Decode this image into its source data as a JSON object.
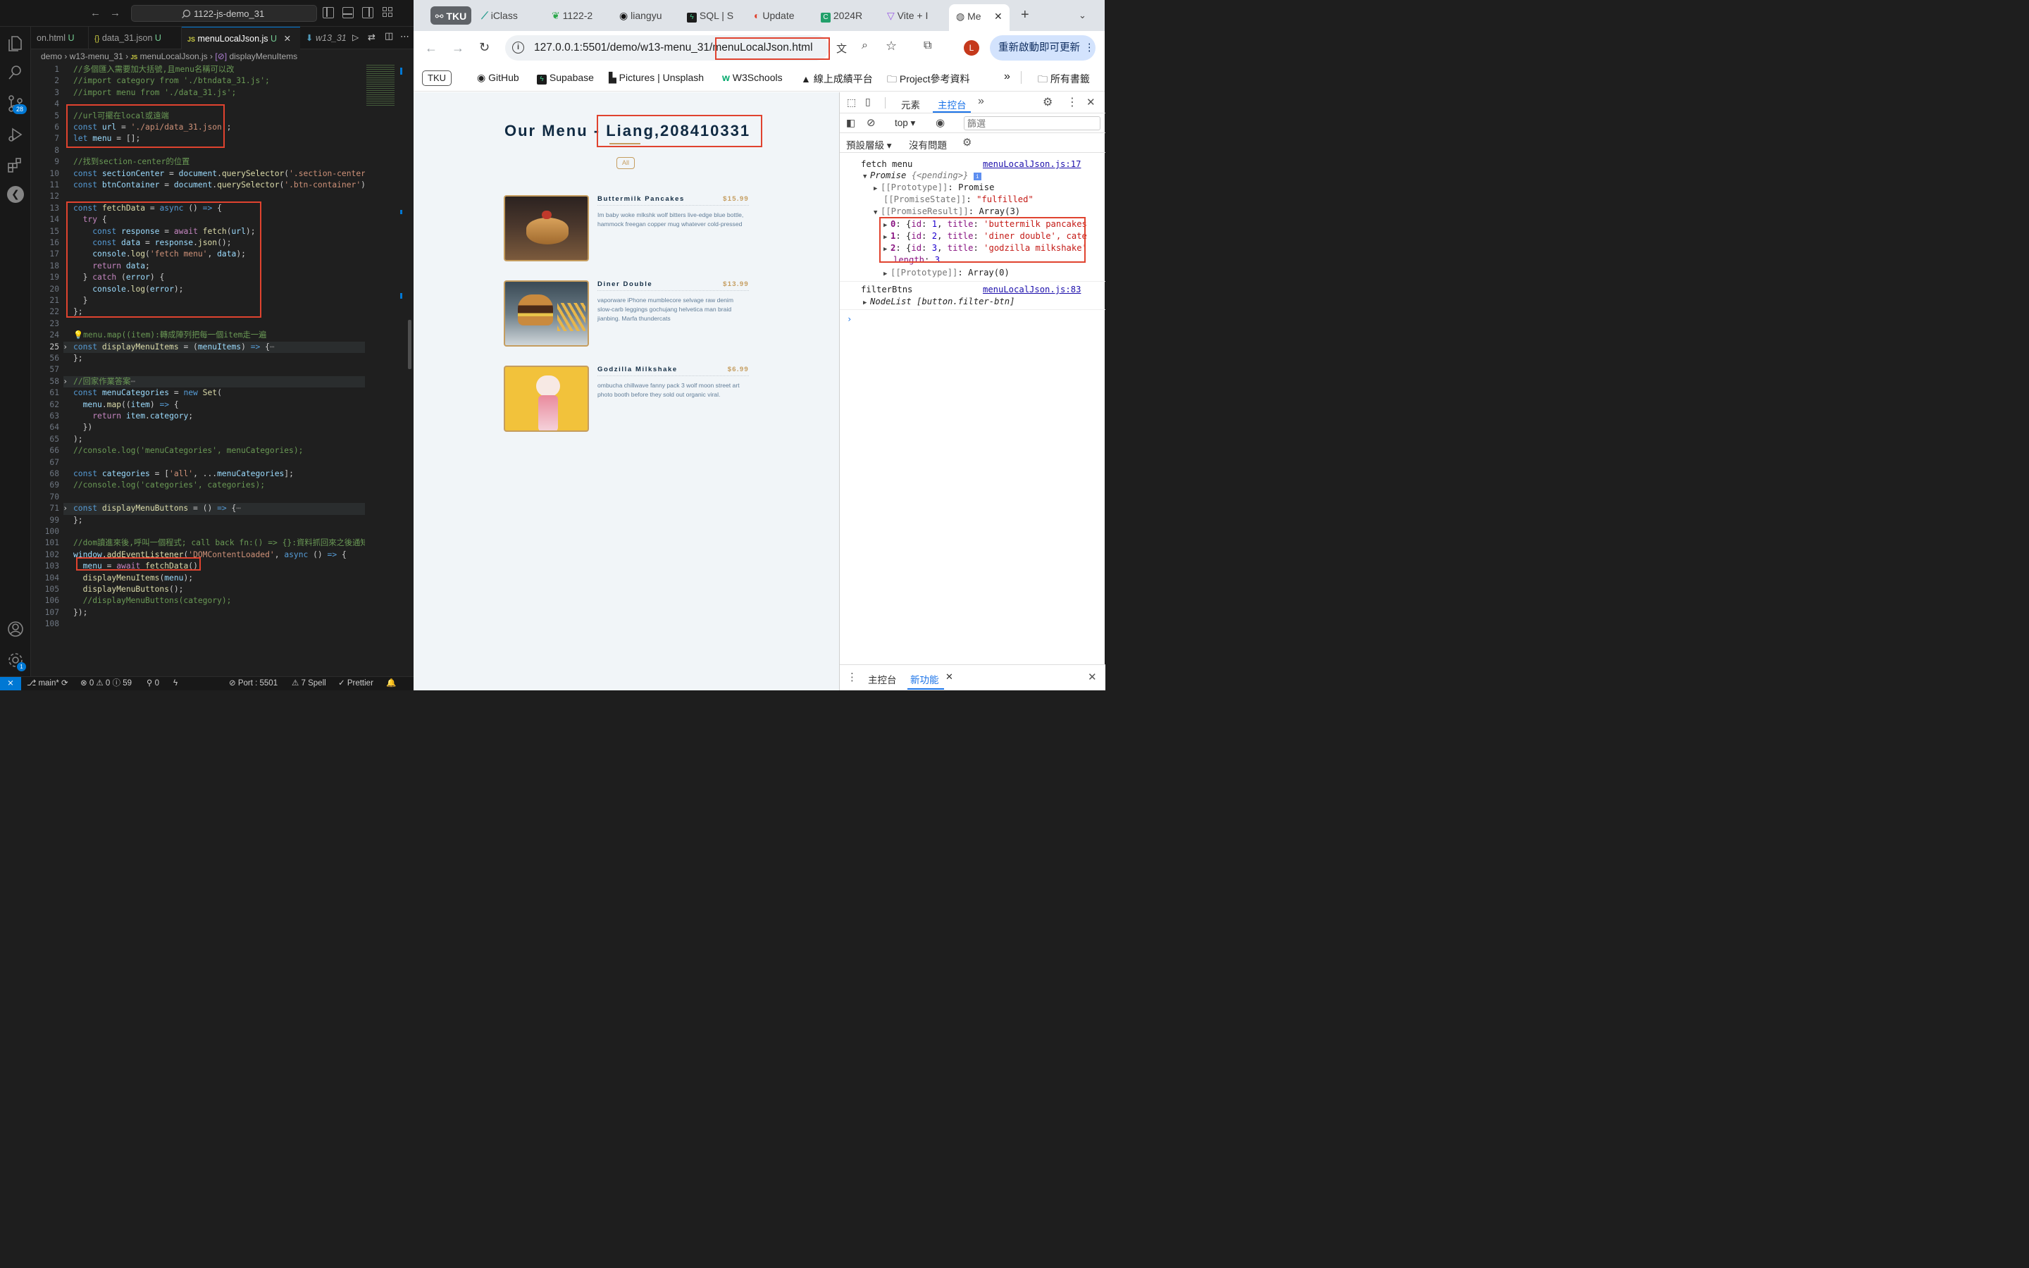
{
  "vscode": {
    "search": "1122-js-demo_31",
    "scm_badge": "28",
    "settings_badge": "1",
    "tabs": [
      {
        "label": "on.html",
        "mod": "U"
      },
      {
        "label": "data_31.json",
        "mod": "U",
        "icon": "{}"
      },
      {
        "label": "menuLocalJson.js",
        "mod": "U",
        "icon": "JS"
      },
      {
        "label": "w13_31",
        "mod": ""
      }
    ],
    "breadcrumb": [
      "demo",
      "w13-menu_31",
      "menuLocalJson.js",
      "displayMenuItems"
    ],
    "lines": [
      {
        "n": "1",
        "segs": [
          [
            "c-com",
            "//多個匯入需要加大括號,且menu名稱可以改"
          ]
        ]
      },
      {
        "n": "2",
        "segs": [
          [
            "c-com",
            "//import category from './btndata_31.js';"
          ]
        ]
      },
      {
        "n": "3",
        "segs": [
          [
            "c-com",
            "//import menu from './data_31.js';"
          ]
        ]
      },
      {
        "n": "4",
        "segs": []
      },
      {
        "n": "5",
        "segs": [
          [
            "c-com",
            "//url可擺在local或遠端"
          ]
        ]
      },
      {
        "n": "6",
        "segs": [
          [
            "c-kw",
            "const "
          ],
          [
            "c-var",
            "url"
          ],
          [
            "",
            " = "
          ],
          [
            "c-str",
            "'./api/data_31.json'"
          ],
          [
            "",
            ";"
          ]
        ]
      },
      {
        "n": "7",
        "segs": [
          [
            "c-kw",
            "let "
          ],
          [
            "c-var",
            "menu"
          ],
          [
            "",
            " = [];"
          ]
        ]
      },
      {
        "n": "8",
        "segs": []
      },
      {
        "n": "9",
        "segs": [
          [
            "c-com",
            "//找到section-center的位置"
          ]
        ]
      },
      {
        "n": "10",
        "segs": [
          [
            "c-kw",
            "const "
          ],
          [
            "c-var",
            "sectionCenter"
          ],
          [
            "",
            " = "
          ],
          [
            "c-var",
            "document"
          ],
          [
            "",
            "."
          ],
          [
            "c-fn",
            "querySelector"
          ],
          [
            "",
            "("
          ],
          [
            "c-str",
            "'.section-center'"
          ],
          [
            "",
            ")"
          ]
        ]
      },
      {
        "n": "11",
        "segs": [
          [
            "c-kw",
            "const "
          ],
          [
            "c-var",
            "btnContainer"
          ],
          [
            "",
            " = "
          ],
          [
            "c-var",
            "document"
          ],
          [
            "",
            "."
          ],
          [
            "c-fn",
            "querySelector"
          ],
          [
            "",
            "("
          ],
          [
            "c-str",
            "'.btn-container'"
          ],
          [
            "",
            ");"
          ]
        ]
      },
      {
        "n": "12",
        "segs": []
      },
      {
        "n": "13",
        "segs": [
          [
            "c-kw",
            "const "
          ],
          [
            "c-fn",
            "fetchData"
          ],
          [
            "",
            " = "
          ],
          [
            "c-kw",
            "async"
          ],
          [
            "",
            " () "
          ],
          [
            "c-kw",
            "=>"
          ],
          [
            "",
            " {"
          ]
        ]
      },
      {
        "n": "14",
        "segs": [
          [
            "",
            "  "
          ],
          [
            "c-ctl",
            "try"
          ],
          [
            "",
            " {"
          ]
        ]
      },
      {
        "n": "15",
        "segs": [
          [
            "",
            "    "
          ],
          [
            "c-kw",
            "const "
          ],
          [
            "c-var",
            "response"
          ],
          [
            "",
            " = "
          ],
          [
            "c-ctl",
            "await "
          ],
          [
            "c-fn",
            "fetch"
          ],
          [
            "",
            "("
          ],
          [
            "c-var",
            "url"
          ],
          [
            "",
            ");"
          ]
        ]
      },
      {
        "n": "16",
        "segs": [
          [
            "",
            "    "
          ],
          [
            "c-kw",
            "const "
          ],
          [
            "c-var",
            "data"
          ],
          [
            "",
            " = "
          ],
          [
            "c-var",
            "response"
          ],
          [
            "",
            "."
          ],
          [
            "c-fn",
            "json"
          ],
          [
            "",
            "();"
          ]
        ]
      },
      {
        "n": "17",
        "segs": [
          [
            "",
            "    "
          ],
          [
            "c-var",
            "console"
          ],
          [
            "",
            "."
          ],
          [
            "c-fn",
            "log"
          ],
          [
            "",
            "("
          ],
          [
            "c-str",
            "'fetch menu'"
          ],
          [
            "",
            ", "
          ],
          [
            "c-var",
            "data"
          ],
          [
            "",
            ");"
          ]
        ]
      },
      {
        "n": "18",
        "segs": [
          [
            "",
            "    "
          ],
          [
            "c-ctl",
            "return "
          ],
          [
            "c-var",
            "data"
          ],
          [
            "",
            ";"
          ]
        ]
      },
      {
        "n": "19",
        "segs": [
          [
            "",
            "  } "
          ],
          [
            "c-ctl",
            "catch"
          ],
          [
            "",
            " ("
          ],
          [
            "c-var",
            "error"
          ],
          [
            "",
            ") {"
          ]
        ]
      },
      {
        "n": "20",
        "segs": [
          [
            "",
            "    "
          ],
          [
            "c-var",
            "console"
          ],
          [
            "",
            "."
          ],
          [
            "c-fn",
            "log"
          ],
          [
            "",
            "("
          ],
          [
            "c-var",
            "error"
          ],
          [
            "",
            ");"
          ]
        ]
      },
      {
        "n": "21",
        "segs": [
          [
            "",
            "  }"
          ]
        ]
      },
      {
        "n": "22",
        "segs": [
          [
            "",
            "};"
          ]
        ]
      },
      {
        "n": "23",
        "segs": []
      },
      {
        "n": "24",
        "segs": [
          [
            "c-com",
            "💡menu.map((item):轉成陣列把每一個item走一遍"
          ]
        ]
      },
      {
        "n": "25",
        "fold": true,
        "segs": [
          [
            "c-kw",
            "const "
          ],
          [
            "c-fn",
            "displayMenuItems"
          ],
          [
            "",
            " = ("
          ],
          [
            "c-var",
            "menuItems"
          ],
          [
            "",
            ") "
          ],
          [
            "c-kw",
            "=>"
          ],
          [
            "",
            " {"
          ],
          [
            "c-gray",
            "⋯"
          ]
        ]
      },
      {
        "n": "56",
        "segs": [
          [
            "",
            "};"
          ]
        ]
      },
      {
        "n": "57",
        "segs": []
      },
      {
        "n": "58",
        "fold": true,
        "segs": [
          [
            "c-com",
            "//回家作業答案"
          ],
          [
            "c-gray",
            "⋯"
          ]
        ]
      },
      {
        "n": "61",
        "segs": [
          [
            "c-kw",
            "const "
          ],
          [
            "c-var",
            "menuCategories"
          ],
          [
            "",
            " = "
          ],
          [
            "c-kw",
            "new "
          ],
          [
            "c-fn",
            "Set"
          ],
          [
            "",
            "("
          ]
        ]
      },
      {
        "n": "62",
        "segs": [
          [
            "",
            "  "
          ],
          [
            "c-var",
            "menu"
          ],
          [
            "",
            "."
          ],
          [
            "c-fn",
            "map"
          ],
          [
            "",
            "(("
          ],
          [
            "c-var",
            "item"
          ],
          [
            "",
            ") "
          ],
          [
            "c-kw",
            "=>"
          ],
          [
            "",
            " {"
          ]
        ]
      },
      {
        "n": "63",
        "segs": [
          [
            "",
            "    "
          ],
          [
            "c-ctl",
            "return "
          ],
          [
            "c-var",
            "item"
          ],
          [
            "",
            "."
          ],
          [
            "c-var",
            "category"
          ],
          [
            "",
            ";"
          ]
        ]
      },
      {
        "n": "64",
        "segs": [
          [
            "",
            "  })"
          ]
        ]
      },
      {
        "n": "65",
        "segs": [
          [
            "",
            ");"
          ]
        ]
      },
      {
        "n": "66",
        "segs": [
          [
            "c-com",
            "//console.log('menuCategories', menuCategories);"
          ]
        ]
      },
      {
        "n": "67",
        "segs": []
      },
      {
        "n": "68",
        "segs": [
          [
            "c-kw",
            "const "
          ],
          [
            "c-var",
            "categories"
          ],
          [
            "",
            " = ["
          ],
          [
            "c-str",
            "'all'"
          ],
          [
            "",
            ", ..."
          ],
          [
            "c-var",
            "menuCategories"
          ],
          [
            "",
            "];"
          ]
        ]
      },
      {
        "n": "69",
        "segs": [
          [
            "c-com",
            "//console.log('categories', categories);"
          ]
        ]
      },
      {
        "n": "70",
        "segs": []
      },
      {
        "n": "71",
        "fold": true,
        "segs": [
          [
            "c-kw",
            "const "
          ],
          [
            "c-fn",
            "displayMenuButtons"
          ],
          [
            "",
            " = () "
          ],
          [
            "c-kw",
            "=>"
          ],
          [
            "",
            " {"
          ],
          [
            "c-gray",
            "⋯"
          ]
        ]
      },
      {
        "n": "99",
        "segs": [
          [
            "",
            "};"
          ]
        ]
      },
      {
        "n": "100",
        "segs": []
      },
      {
        "n": "101",
        "segs": [
          [
            "c-com",
            "//dom讀進來後,呼叫一個程式; call back fn:() => {}:資料抓回來之後通知"
          ]
        ]
      },
      {
        "n": "102",
        "segs": [
          [
            "c-var",
            "window"
          ],
          [
            "",
            "."
          ],
          [
            "c-fn",
            "addEventListener"
          ],
          [
            "",
            "("
          ],
          [
            "c-str",
            "'DOMContentLoaded'"
          ],
          [
            "",
            ", "
          ],
          [
            "c-kw",
            "async"
          ],
          [
            "",
            " () "
          ],
          [
            "c-kw",
            "=>"
          ],
          [
            "",
            " {"
          ]
        ]
      },
      {
        "n": "103",
        "segs": [
          [
            "",
            "  "
          ],
          [
            "c-var",
            "menu"
          ],
          [
            "",
            " = "
          ],
          [
            "c-ctl",
            "await "
          ],
          [
            "c-fn",
            "fetchData"
          ],
          [
            "",
            "();"
          ]
        ]
      },
      {
        "n": "104",
        "segs": [
          [
            "",
            "  "
          ],
          [
            "c-fn",
            "displayMenuItems"
          ],
          [
            "",
            "("
          ],
          [
            "c-var",
            "menu"
          ],
          [
            "",
            ");"
          ]
        ]
      },
      {
        "n": "105",
        "segs": [
          [
            "",
            "  "
          ],
          [
            "c-fn",
            "displayMenuButtons"
          ],
          [
            "",
            "();"
          ]
        ]
      },
      {
        "n": "106",
        "segs": [
          [
            "",
            "  "
          ],
          [
            "c-com",
            "//displayMenuButtons(category);"
          ]
        ]
      },
      {
        "n": "107",
        "segs": [
          [
            "",
            "});"
          ]
        ]
      },
      {
        "n": "108",
        "segs": []
      }
    ],
    "status": {
      "branch": "main*",
      "problems": "⊗ 0 ⚠ 0 ⓘ 59",
      "ports": "⚲ 0",
      "port": "Port : 5501",
      "spell": "7 Spell",
      "prettier": "Prettier"
    }
  },
  "chrome": {
    "tabs": [
      {
        "label": "TKU",
        "pinned": true
      },
      {
        "label": "iClass"
      },
      {
        "label": "1122-2"
      },
      {
        "label": "liangyu"
      },
      {
        "label": "SQL | S"
      },
      {
        "label": "Update"
      },
      {
        "label": "2024R"
      },
      {
        "label": "Vite + I"
      },
      {
        "label": "Me",
        "active": true
      }
    ],
    "url_prefix": "127.0.0.1:5501/demo/w13-menu_31/",
    "url_file": "menuLocalJson.html",
    "update_button": "重新啟動即可更新",
    "profile_initial": "L",
    "bookmarks": [
      "TKU",
      "GitHub",
      "Supabase",
      "Pictures | Unsplash",
      "W3Schools",
      "線上成績平台",
      "Project參考資料"
    ],
    "all_bookmarks": "所有書籤"
  },
  "page": {
    "title_prefix": "Our Menu - ",
    "title_name": "Liang,208410331",
    "filter_button": "All",
    "items": [
      {
        "title": "Buttermilk Pancakes",
        "price": "$15.99",
        "desc": "Im baby woke mlkshk wolf bitters live-edge blue bottle, hammock freegan copper mug whatever cold-pressed"
      },
      {
        "title": "Diner Double",
        "price": "$13.99",
        "desc": "vaporware iPhone mumblecore selvage raw denim slow-carb leggings gochujang helvetica man braid jianbing. Marfa thundercats"
      },
      {
        "title": "Godzilla Milkshake",
        "price": "$6.99",
        "desc": "ombucha chillwave fanny pack 3 wolf moon street art photo booth before they sold out organic viral."
      }
    ]
  },
  "devtools": {
    "tabs": [
      "元素",
      "主控台"
    ],
    "context": "top",
    "filter_placeholder": "篩選",
    "levels": "預設層級",
    "issues": "沒有問題",
    "log1_msg": "fetch menu",
    "log1_src": "menuLocalJson.js:17",
    "promise_label": "Promise",
    "promise_state": "{<pending>}",
    "proto_promise_key": "[[Prototype]]",
    "proto_promise_val": "Promise",
    "state_key": "[[PromiseState]]",
    "state_val": "\"fulfilled\"",
    "result_key": "[[PromiseResult]]",
    "result_val": "Array(3)",
    "entries": [
      {
        "idx": "0",
        "id": "1",
        "title": "'buttermilk pancakes"
      },
      {
        "idx": "1",
        "id": "2",
        "title": "'diner double', cate"
      },
      {
        "idx": "2",
        "id": "3",
        "title": "'godzilla milkshake'"
      }
    ],
    "length_key": "length",
    "length_val": "3",
    "proto_array_key": "[[Prototype]]",
    "proto_array_val": "Array(0)",
    "log2_msg": "filterBtns",
    "log2_src": "menuLocalJson.js:83",
    "nodelist": "NodeList [button.filter-btn]",
    "drawer_tabs": [
      "主控台",
      "新功能"
    ]
  }
}
